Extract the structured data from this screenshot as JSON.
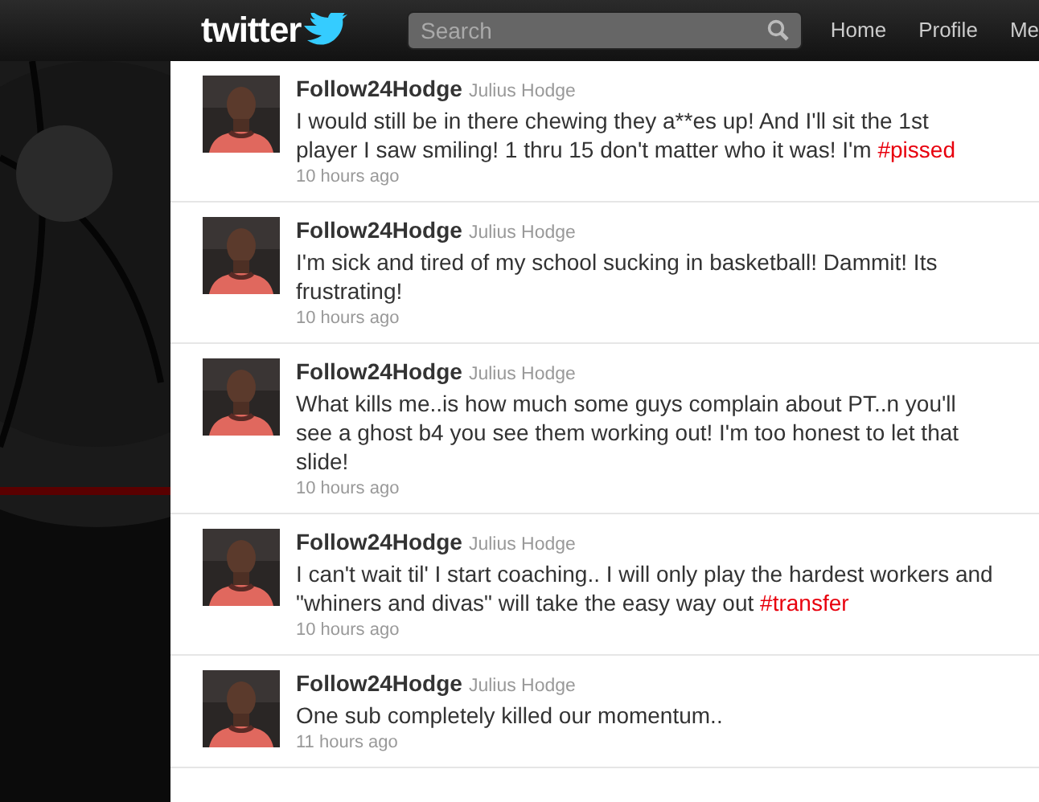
{
  "header": {
    "logo": "twitter",
    "search": {
      "placeholder": "Search"
    },
    "nav": [
      "Home",
      "Profile",
      "Me"
    ]
  },
  "tweets": [
    {
      "user": "Follow24Hodge",
      "name": "Julius Hodge",
      "body": [
        {
          "kind": "text",
          "text": "I would still be in there chewing they a**es up! And I'll sit the 1st player I saw smiling! 1 thru 15 don't matter who it was! I'm "
        },
        {
          "kind": "hashtag",
          "text": "#pissed"
        }
      ],
      "time": "10 hours ago"
    },
    {
      "user": "Follow24Hodge",
      "name": "Julius Hodge",
      "body": [
        {
          "kind": "text",
          "text": "I'm sick and tired of my school sucking in basketball! Dammit! Its frustrating!"
        }
      ],
      "time": "10 hours ago"
    },
    {
      "user": "Follow24Hodge",
      "name": "Julius Hodge",
      "body": [
        {
          "kind": "text",
          "text": "What kills me..is how much some guys complain about PT..n you'll see a ghost b4 you see them working out! I'm too honest to let that slide!"
        }
      ],
      "time": "10 hours ago"
    },
    {
      "user": "Follow24Hodge",
      "name": "Julius Hodge",
      "body": [
        {
          "kind": "text",
          "text": "I can't wait til' I start coaching.. I will only play the hardest workers and \"whiners and divas\" will take the easy way out "
        },
        {
          "kind": "hashtag",
          "text": "#transfer"
        }
      ],
      "time": "10 hours ago"
    },
    {
      "user": "Follow24Hodge",
      "name": "Julius Hodge",
      "body": [
        {
          "kind": "text",
          "text": "One sub completely killed our momentum.."
        }
      ],
      "time": "11 hours ago"
    }
  ]
}
